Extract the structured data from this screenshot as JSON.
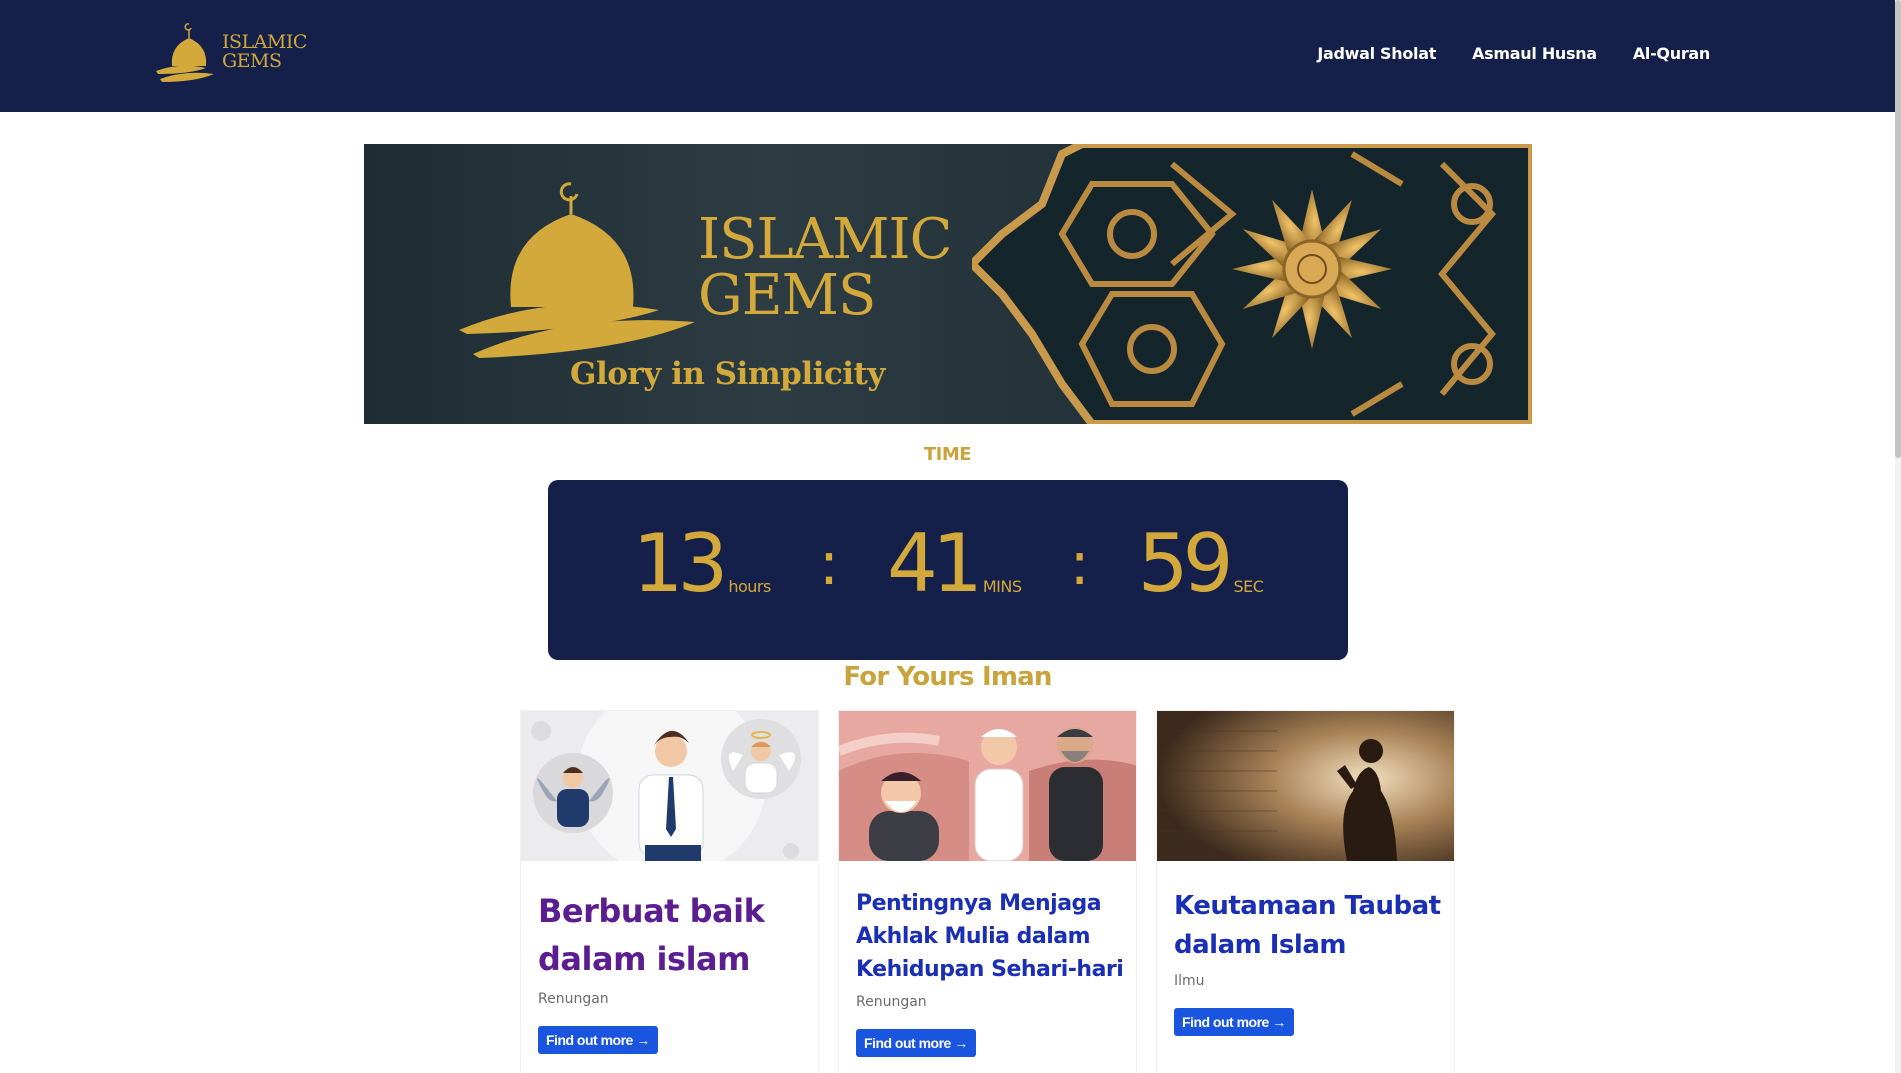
{
  "navbar": {
    "logo_text_line1": "ISLAMIC",
    "logo_text_line2": "GEMS",
    "links": [
      {
        "label": "Jadwal Sholat"
      },
      {
        "label": "Asmaul Husna"
      },
      {
        "label": "Al-Quran"
      }
    ]
  },
  "hero": {
    "title_line1": "ISLAMIC",
    "title_line2": "GEMS",
    "tagline": "Glory in Simplicity"
  },
  "time": {
    "label": "TIME",
    "hours": "13",
    "hours_unit": "hours",
    "minutes": "41",
    "minutes_unit": "MINS",
    "seconds": "59",
    "seconds_unit": "SEC",
    "separator": ":"
  },
  "section": {
    "title": "For Yours Iman"
  },
  "cards": [
    {
      "title": "Berbuat baik dalam islam",
      "category": "Renungan",
      "button": "Find out more →"
    },
    {
      "title": "Pentingnya Menjaga Akhlak Mulia dalam Kehidupan Sehari-hari",
      "category": "Renungan",
      "button": "Find out more →"
    },
    {
      "title": "Keutamaan Taubat dalam Islam",
      "category": "Ilmu",
      "button": "Find out more →"
    }
  ],
  "colors": {
    "navy": "#142049",
    "gold": "#d3a93c",
    "purple_title": "#5b1d8f",
    "blue_title": "#1a2fb4",
    "button_blue": "#1a55e0"
  }
}
